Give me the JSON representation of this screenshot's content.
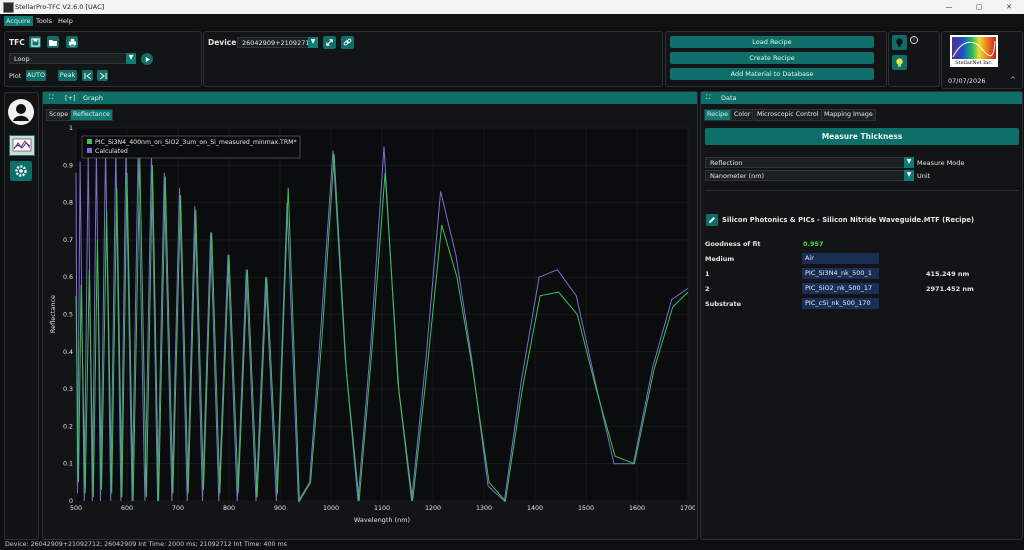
{
  "window": {
    "title": "StellarPro-TFC V2.6.0 [UAC]",
    "controls": [
      "—",
      "▢",
      "✕"
    ]
  },
  "menu": [
    "Acquire",
    "Tools",
    "Help"
  ],
  "tfc": {
    "label": "TFC",
    "mode_value": "Loop",
    "plot_label": "Plot",
    "auto_label": "AUTO",
    "peak_label": "Peak"
  },
  "device": {
    "label": "Device",
    "value": "26042909+21092712"
  },
  "recipe_buttons": [
    "Load Recipe",
    "Create Recipe",
    "Add Material to Database"
  ],
  "logo_text": "StellarNet Inc.",
  "date": "07/07/2026",
  "graph_panel": {
    "toggle": "[+]",
    "title": "Graph",
    "tabs": [
      "Scope",
      "Reflectance"
    ],
    "active_tab": "Reflectance"
  },
  "chart_data": {
    "type": "line",
    "xlabel": "Wavelength (nm)",
    "ylabel": "Reflectance",
    "xlim": [
      500,
      1700
    ],
    "ylim": [
      0,
      1
    ],
    "x_ticks": [
      "500",
      "600",
      "700",
      "800",
      "900",
      "1000",
      "1100",
      "1200",
      "1300",
      "1400",
      "1500",
      "1600",
      "1700"
    ],
    "y_ticks": [
      "0",
      "0.1",
      "0.2",
      "0.3",
      "0.4",
      "0.5",
      "0.6",
      "0.7",
      "0.8",
      "0.9",
      "1"
    ],
    "grid": true,
    "legend": "top-left",
    "series": [
      {
        "name": "PIC_Si3N4_400nm_on_SiO2_3um_on_Si_measured_minmax.TRM*",
        "color": "#3fbf55",
        "x": [
          500,
          505,
          510,
          518,
          526,
          534,
          542,
          550,
          560,
          570,
          580,
          590,
          600,
          612,
          625,
          638,
          650,
          662,
          675,
          690,
          705,
          720,
          735,
          750,
          766,
          782,
          800,
          818,
          836,
          855,
          874,
          895,
          916,
          938,
          960,
          983,
          1006,
          1030,
          1055,
          1080,
          1106,
          1133,
          1160,
          1188,
          1217,
          1247,
          1278,
          1310,
          1342,
          1375,
          1410,
          1446,
          1483,
          1520,
          1557,
          1595,
          1633,
          1670,
          1700
        ],
        "y": [
          0.55,
          0.05,
          0.58,
          0.02,
          0.62,
          0.01,
          0.7,
          0.03,
          0.78,
          0.02,
          0.84,
          0.01,
          0.88,
          0.0,
          0.92,
          0.01,
          0.9,
          0.0,
          0.87,
          0.02,
          0.82,
          0.02,
          0.78,
          0.03,
          0.72,
          0.02,
          0.66,
          0.02,
          0.62,
          0.01,
          0.6,
          0.02,
          0.84,
          0.0,
          0.05,
          0.45,
          0.93,
          0.35,
          0.0,
          0.4,
          0.88,
          0.3,
          0.0,
          0.35,
          0.74,
          0.6,
          0.35,
          0.05,
          0.0,
          0.3,
          0.55,
          0.56,
          0.5,
          0.3,
          0.12,
          0.1,
          0.35,
          0.52,
          0.56
        ]
      },
      {
        "name": "Calculated",
        "color": "#7b6fd6",
        "x": [
          500,
          503,
          508,
          516,
          524,
          532,
          540,
          548,
          558,
          568,
          578,
          588,
          598,
          610,
          622,
          635,
          648,
          660,
          673,
          688,
          703,
          718,
          733,
          748,
          764,
          780,
          798,
          816,
          834,
          853,
          872,
          893,
          914,
          936,
          958,
          981,
          1004,
          1028,
          1053,
          1078,
          1104,
          1131,
          1158,
          1186,
          1215,
          1245,
          1276,
          1308,
          1340,
          1373,
          1408,
          1444,
          1481,
          1518,
          1555,
          1593,
          1631,
          1668,
          1700
        ],
        "y": [
          0.88,
          0.02,
          0.91,
          0.0,
          0.93,
          0.0,
          0.94,
          0.0,
          0.95,
          0.0,
          0.95,
          0.0,
          0.95,
          0.0,
          0.94,
          0.0,
          0.93,
          0.0,
          0.88,
          0.0,
          0.84,
          0.0,
          0.79,
          0.0,
          0.72,
          0.0,
          0.66,
          0.0,
          0.62,
          0.0,
          0.6,
          0.0,
          0.8,
          0.0,
          0.05,
          0.48,
          0.94,
          0.38,
          0.0,
          0.42,
          0.95,
          0.32,
          0.0,
          0.38,
          0.83,
          0.66,
          0.38,
          0.04,
          0.0,
          0.32,
          0.6,
          0.62,
          0.55,
          0.32,
          0.1,
          0.1,
          0.36,
          0.54,
          0.57
        ]
      }
    ]
  },
  "data_panel": {
    "title": "Data",
    "tabs": [
      "Recipe",
      "Color",
      "Microscopic Control",
      "Mapping Image"
    ],
    "active_tab": "Recipe",
    "measure_button": "Measure Thickness",
    "measure_mode_value": "Reflection",
    "measure_mode_label": "Measure Mode",
    "unit_value": "Nanometer (nm)",
    "unit_label": "Unit",
    "recipe_title": "Silicon Photonics & PICs - Silicon Nitride Waveguide.MTF (Recipe)",
    "gof_label": "Goodness of fit",
    "gof_value": "0.957",
    "medium_label": "Medium",
    "medium_value": "Air",
    "layers": [
      {
        "index": "1",
        "material": "PIC_Si3N4_nk_500_1",
        "thickness": "415.249 nm"
      },
      {
        "index": "2",
        "material": "PIC_SiO2_nk_500_17",
        "thickness": "2971.452 nm"
      }
    ],
    "substrate_label": "Substrate",
    "substrate_value": "PIC_cSi_nk_500_170"
  },
  "status": "Device: 26042909+21092712;  26042909 Int Time: 2000 ms;  21092712 Int Time: 400 ms",
  "colors": {
    "accent": "#0e7c74",
    "background": "#0d0f10",
    "panel": "#121415",
    "fit_green": "#3fe03f",
    "recipe_blue": "#1b2f56"
  }
}
